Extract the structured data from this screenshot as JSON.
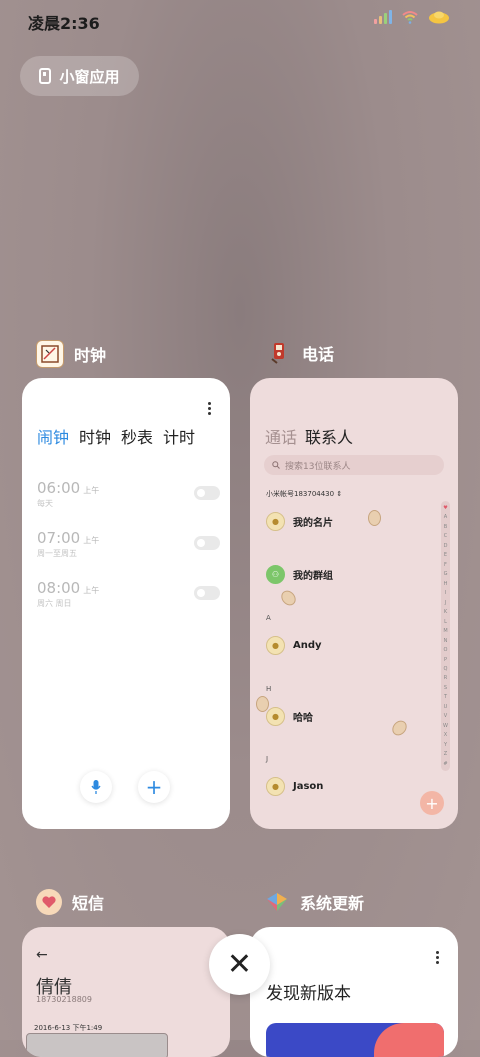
{
  "status_bar": {
    "time": "凌晨2:36"
  },
  "small_window": {
    "label": "小窗应用"
  },
  "apps": {
    "clock": {
      "name": "时钟",
      "tabs": [
        "闹钟",
        "时钟",
        "秒表",
        "计时"
      ],
      "alarms": [
        {
          "time": "06:00",
          "ampm": "上午",
          "repeat": "每天"
        },
        {
          "time": "07:00",
          "ampm": "上午",
          "repeat": "周一至周五"
        },
        {
          "time": "08:00",
          "ampm": "上午",
          "repeat": "周六 周日"
        }
      ]
    },
    "phone": {
      "name": "电话",
      "tabs": [
        "通话",
        "联系人"
      ],
      "search_placeholder": "搜索13位联系人",
      "account": "小米帐号183704430",
      "contacts": [
        {
          "section": "",
          "name": "我的名片"
        },
        {
          "section": "",
          "name": "我的群组"
        },
        {
          "section": "A",
          "name": "Andy"
        },
        {
          "section": "H",
          "name": "哈哈"
        },
        {
          "section": "J",
          "name": "Jason"
        }
      ],
      "index_letters": [
        "♥",
        "A",
        "B",
        "C",
        "D",
        "E",
        "F",
        "G",
        "H",
        "I",
        "J",
        "K",
        "L",
        "M",
        "N",
        "O",
        "P",
        "Q",
        "R",
        "S",
        "T",
        "U",
        "V",
        "W",
        "X",
        "Y",
        "Z",
        "#"
      ]
    },
    "sms": {
      "name": "短信",
      "contact_name": "倩倩",
      "contact_number": "18730218809",
      "timestamp": "2016-6-13 下午1:49"
    },
    "update": {
      "name": "系统更新",
      "title": "发现新版本"
    }
  },
  "colors": {
    "accent": "#2d8ae0",
    "phone_bg": "#eedcdc"
  }
}
